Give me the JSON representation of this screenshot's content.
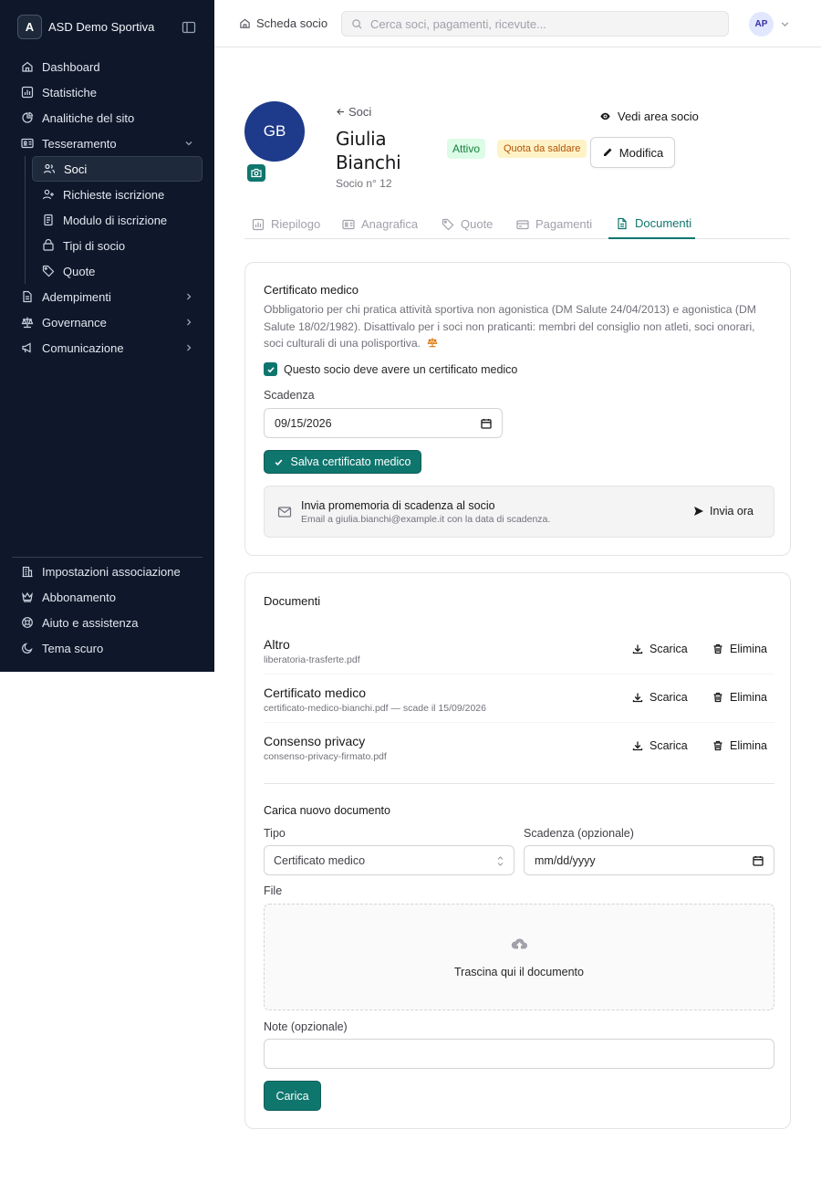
{
  "sidebar": {
    "brand_initial": "A",
    "brand_name": "ASD Demo Sportiva",
    "items": [
      {
        "label": "Dashboard",
        "icon": "home-icon"
      },
      {
        "label": "Statistiche",
        "icon": "chart-icon"
      },
      {
        "label": "Analitiche del sito",
        "icon": "analytics-icon"
      },
      {
        "label": "Tesseramento",
        "icon": "id-card-icon"
      }
    ],
    "sub_items": [
      {
        "label": "Soci",
        "icon": "users-icon",
        "active": true
      },
      {
        "label": "Richieste iscrizione",
        "icon": "user-plus-icon"
      },
      {
        "label": "Modulo di iscrizione",
        "icon": "form-icon"
      },
      {
        "label": "Tipi di socio",
        "icon": "layers-icon"
      },
      {
        "label": "Quote",
        "icon": "tag-icon"
      }
    ],
    "groups": [
      {
        "label": "Adempimenti",
        "icon": "file-icon"
      },
      {
        "label": "Governance",
        "icon": "scale-icon"
      },
      {
        "label": "Comunicazione",
        "icon": "megaphone-icon"
      }
    ],
    "bottom": [
      {
        "label": "Impostazioni associazione",
        "icon": "building-icon"
      },
      {
        "label": "Abbonamento",
        "icon": "crown-icon"
      },
      {
        "label": "Aiuto e assistenza",
        "icon": "lifebuoy-icon"
      },
      {
        "label": "Tema scuro",
        "icon": "moon-icon"
      }
    ]
  },
  "topbar": {
    "breadcrumb": "Scheda socio",
    "search_placeholder": "Cerca soci, pagamenti, ricevute...",
    "user_initials": "AP"
  },
  "profile": {
    "initials": "GB",
    "back_label": "Soci",
    "first_name": "Giulia",
    "last_name": "Bianchi",
    "member_no": "Socio n° 12",
    "status": "Attivo",
    "fee_status": "Quota da saldare",
    "view_area": "Vedi area socio",
    "edit": "Modifica"
  },
  "tabs": [
    {
      "label": "Riepilogo",
      "icon": "chart-icon"
    },
    {
      "label": "Anagrafica",
      "icon": "id-card-icon"
    },
    {
      "label": "Quote",
      "icon": "tag-icon"
    },
    {
      "label": "Pagamenti",
      "icon": "credit-card-icon"
    },
    {
      "label": "Documenti",
      "icon": "document-icon",
      "active": true
    }
  ],
  "certificate": {
    "title": "Certificato medico",
    "description": "Obbligatorio per chi pratica attività sportiva non agonistica (DM Salute 24/04/2013) e agonistica (DM Salute 18/02/1982). Disattivalo per i soci non praticanti: membri del consiglio non atleti, soci onorari, soci culturali di una polisportiva.",
    "required_label": "Questo socio deve avere un certificato medico",
    "expiry_label": "Scadenza",
    "expiry_value": "09/15/2026",
    "save": "Salva certificato medico",
    "reminder_title": "Invia promemoria di scadenza al socio",
    "reminder_sub": "Email a giulia.bianchi@example.it con la data di scadenza.",
    "send_now": "Invia ora"
  },
  "documents": {
    "title": "Documenti",
    "download": "Scarica",
    "delete": "Elimina",
    "list": [
      {
        "name": "Altro",
        "file": "liberatoria-trasferte.pdf"
      },
      {
        "name": "Certificato medico",
        "file": "certificato-medico-bianchi.pdf — scade il 15/09/2026"
      },
      {
        "name": "Consenso privacy",
        "file": "consenso-privacy-firmato.pdf"
      }
    ],
    "upload_title": "Carica nuovo documento",
    "type_label": "Tipo",
    "type_value": "Certificato medico",
    "expiry_label": "Scadenza (opzionale)",
    "expiry_placeholder": "mm/dd/yyyy",
    "file_label": "File",
    "drop_text": "Trascina qui il documento",
    "notes_label": "Note (opzionale)",
    "upload_button": "Carica"
  },
  "colors": {
    "sidebar_bg": "#0f172a",
    "accent": "#0f766e",
    "avatar_bg": "#1e3a8a"
  }
}
